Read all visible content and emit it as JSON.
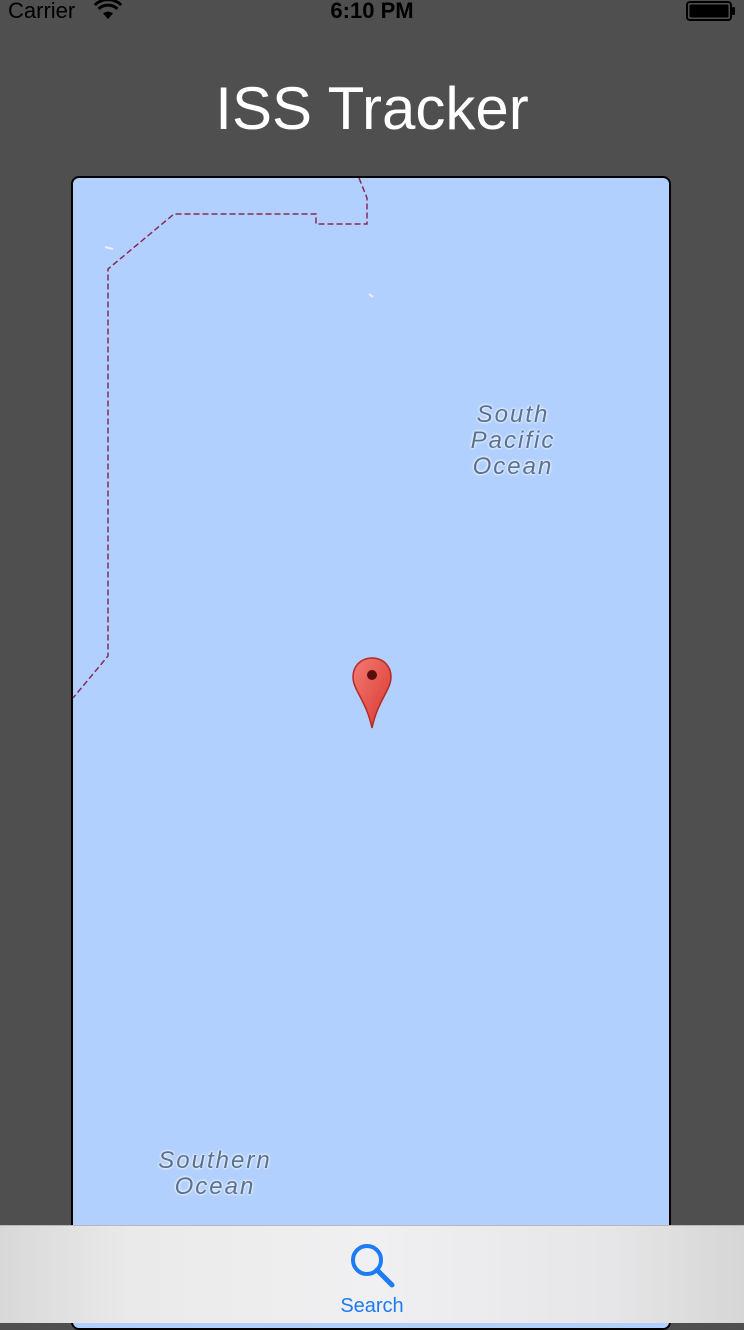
{
  "status_bar": {
    "carrier": "Carrier",
    "time": "6:10 PM",
    "wifi_icon": "wifi-icon",
    "battery_icon": "battery-icon"
  },
  "header": {
    "title": "ISS Tracker"
  },
  "map": {
    "labels": {
      "south_pacific": "South\nPacific\nOcean",
      "southern": "Southern\nOcean"
    },
    "pin_icon": "map-pin-icon",
    "colors": {
      "water": "#b2d0fd",
      "boundary": "#8a2a5a",
      "pin": "#e84a43"
    }
  },
  "tab_bar": {
    "items": [
      {
        "label": "Search",
        "icon": "search-icon"
      }
    ],
    "accent": "#1c7bf5"
  }
}
